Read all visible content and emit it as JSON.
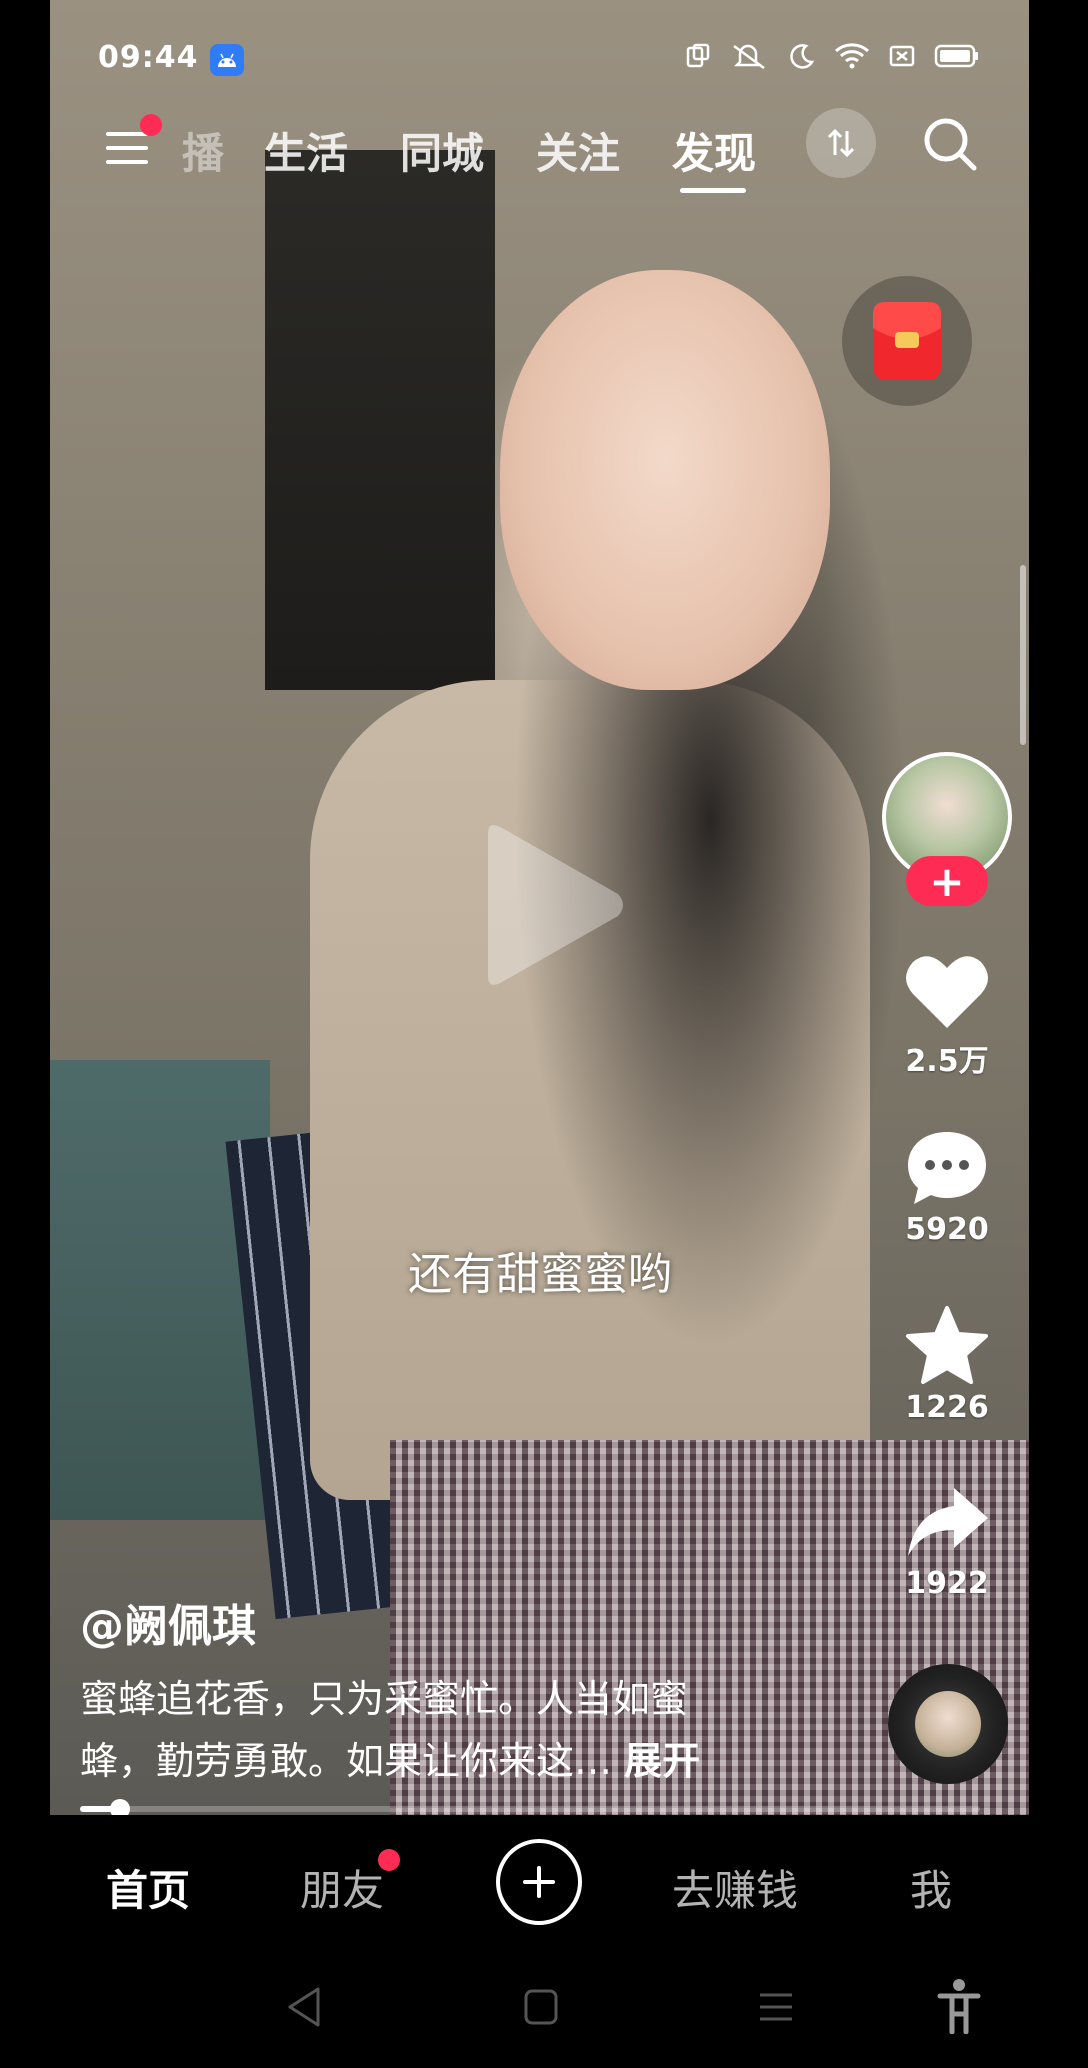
{
  "status_bar": {
    "time": "09:44"
  },
  "top_nav": {
    "tabs": [
      {
        "label": "播",
        "state": "partial"
      },
      {
        "label": "生活",
        "state": "normal"
      },
      {
        "label": "同城",
        "state": "normal"
      },
      {
        "label": "关注",
        "state": "normal"
      },
      {
        "label": "发现",
        "state": "active"
      }
    ]
  },
  "video": {
    "subtitle": "还有甜蜜蜜哟",
    "author": "@阙佩琪",
    "description_line1": "蜜蜂追花香，只为采蜜忙。人当如蜜",
    "description_line2": "蜂，勤劳勇敢。如果让你来这…",
    "expand_label": "展开",
    "progress": 0.04
  },
  "actions": {
    "follow_label": "+",
    "likes": "2.5万",
    "comments": "5920",
    "favorites": "1226",
    "shares": "1922"
  },
  "bottom_tabs": {
    "home": "首页",
    "friends": "朋友",
    "create": "+",
    "earn": "去赚钱",
    "me": "我"
  },
  "colors": {
    "accent": "#fe2c55",
    "app_badge": "#2f7cf6"
  }
}
